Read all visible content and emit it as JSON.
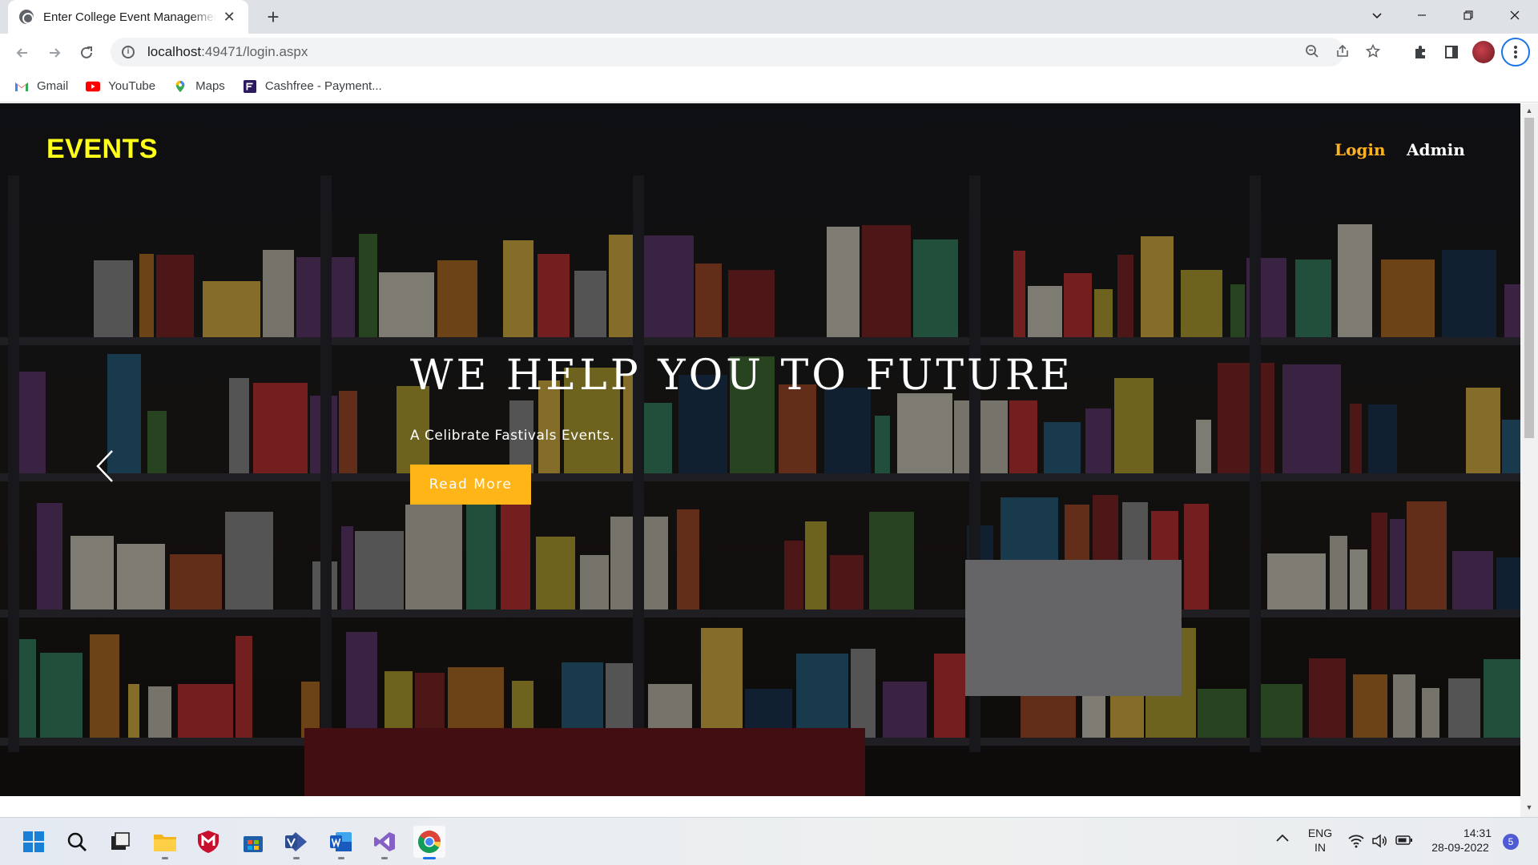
{
  "browser": {
    "tab_title": "Enter College Event Management",
    "tab_close": "✕",
    "new_tab": "+",
    "url_host": "localhost",
    "url_path": ":49471/login.aspx",
    "bookmarks": [
      {
        "label": "Gmail",
        "color": "#ea4335"
      },
      {
        "label": "YouTube",
        "color": "#ff0000"
      },
      {
        "label": "Maps",
        "color": "#34a853"
      },
      {
        "label": "Cashfree - Payment...",
        "color": "#2b1b5e"
      }
    ]
  },
  "page": {
    "brand": "EVENTS",
    "nav": {
      "login": "Login",
      "admin": "Admin"
    },
    "hero": {
      "headline": "WE HELP YOU TO FUTURE",
      "subline": "A Celibrate Fastivals Events.",
      "cta": "Read More"
    },
    "colors": {
      "brand": "#ffff1a",
      "accent": "#ffb518",
      "nav_active": "#ffb220"
    }
  },
  "taskbar": {
    "apps": [
      "start-icon",
      "search-icon",
      "task-view-icon",
      "file-explorer-icon",
      "mcafee-icon",
      "microsoft-store-icon",
      "visio-icon",
      "word-icon",
      "visual-studio-icon",
      "chrome-icon"
    ],
    "tray": {
      "lang_top": "ENG",
      "lang_bottom": "IN",
      "time": "14:31",
      "date": "28-09-2022",
      "notifications": "5"
    }
  }
}
